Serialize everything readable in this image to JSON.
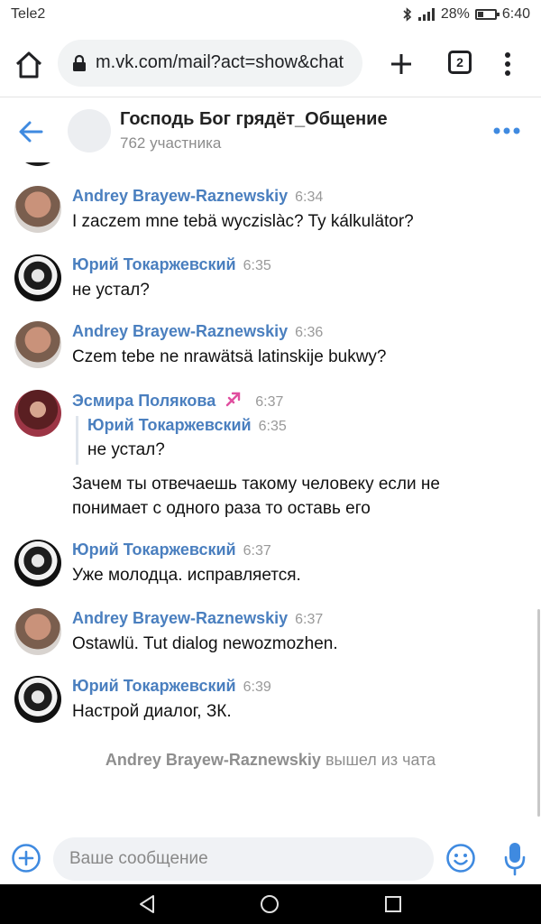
{
  "status_bar": {
    "carrier": "Tele2",
    "battery": "28%",
    "time": "6:40"
  },
  "browser": {
    "url": "m.vk.com/mail?act=show&chat",
    "tab_count": "2"
  },
  "chat": {
    "title": "Господь Бог грядёт_Общение",
    "subtitle": "762 участника"
  },
  "messages": [
    {
      "author": "Andrey Brayew-Raznewskiy",
      "time": "6:34",
      "text": "I zaczem mne tebä wyczislàc? Ty kálkulätor?"
    },
    {
      "author": "Юрий Токаржевский",
      "time": "6:35",
      "text": "не устал?"
    },
    {
      "author": "Andrey Brayew-Raznewskiy",
      "time": "6:36",
      "text": "Czem tebe ne nrawätsä latinskije bukwy?"
    },
    {
      "author": "Эсмира Полякова",
      "time": "6:37",
      "quote": {
        "author": "Юрий Токаржевский",
        "time": "6:35",
        "text": "не устал?"
      },
      "text_lines": [
        "Зачем ты отвечаешь такому человеку если не",
        "понимает с одного раза то оставь его"
      ]
    },
    {
      "author": "Юрий Токаржевский",
      "time": "6:37",
      "text": "Уже молодца. исправляется."
    },
    {
      "author": "Andrey Brayew-Raznewskiy",
      "time": "6:37",
      "text": "Ostawlü. Tut dialog newozmozhen."
    },
    {
      "author": "Юрий Токаржевский",
      "time": "6:39",
      "text": "Настрой диалог, ЗК."
    }
  ],
  "system_message": {
    "name": "Andrey Brayew-Raznewskiy",
    "action": "вышел из чата"
  },
  "composer": {
    "placeholder": "Ваше сообщение"
  },
  "colors": {
    "accent": "#4a7fbf",
    "icon_blue": "#3f8ae0",
    "muted": "#8c8c8c"
  },
  "icons": [
    "home-icon",
    "lock-icon",
    "plus-icon",
    "tabs-icon",
    "more-vert-icon",
    "back-arrow-icon",
    "more-horizontal-icon",
    "add-circle-icon",
    "emoji-icon",
    "mic-icon",
    "nav-back-icon",
    "nav-home-icon",
    "nav-recents-icon",
    "bluetooth-icon",
    "signal-icon",
    "battery-icon"
  ]
}
